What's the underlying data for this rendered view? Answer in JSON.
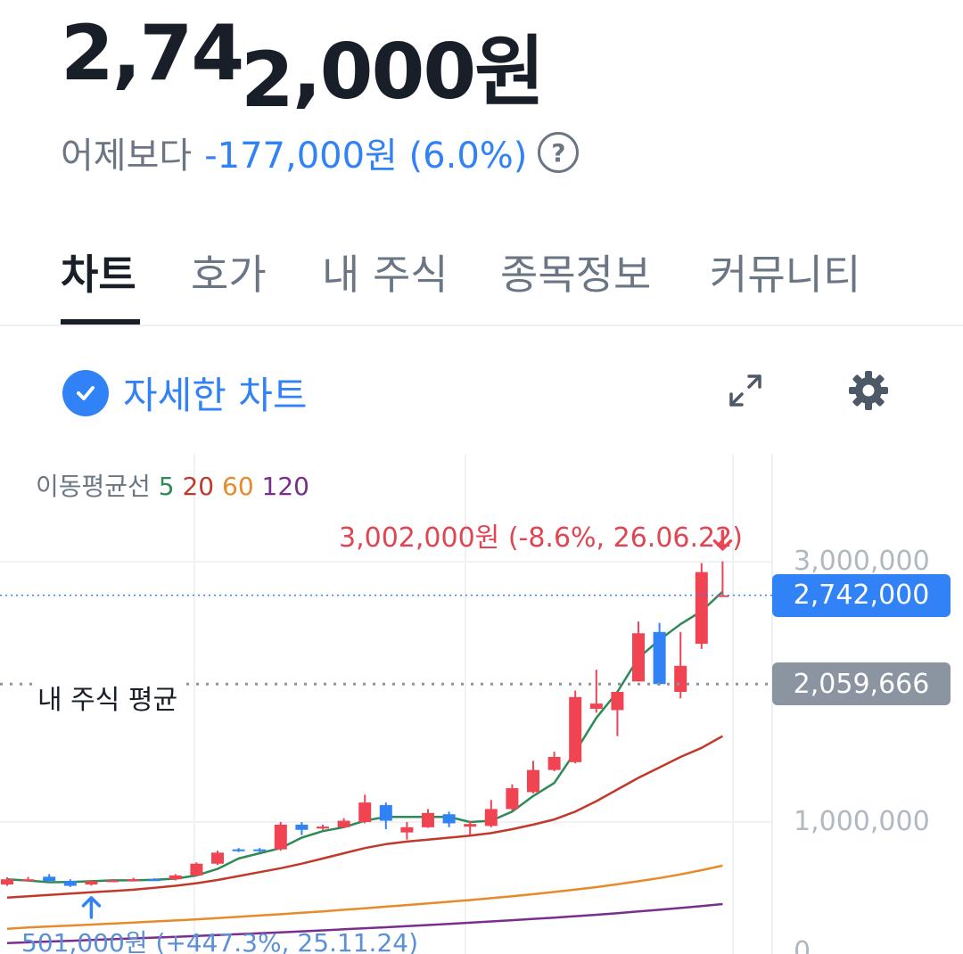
{
  "price": {
    "part_a": "2,74",
    "part_b": "2",
    "part_c": ",000원"
  },
  "change": {
    "label": "어제보다",
    "value": "-177,000원 (6.0%)",
    "help_icon": "question-circle-icon"
  },
  "tabs": [
    {
      "label": "차트",
      "active": true
    },
    {
      "label": "호가",
      "active": false
    },
    {
      "label": "내 주식",
      "active": false
    },
    {
      "label": "종목정보",
      "active": false
    },
    {
      "label": "커뮤니티",
      "active": false
    }
  ],
  "toolbar": {
    "detail_label": "자세한 차트",
    "detail_checked": true,
    "expand_icon": "expand-icon",
    "settings_icon": "gear-icon"
  },
  "colors": {
    "accent": "#3182f6",
    "up": "#f04452",
    "down": "#3182f6",
    "ma5": "#2e8b57",
    "ma20": "#c0392b",
    "ma60": "#e8892b",
    "ma120": "#7b2d8e",
    "avg_badge": "#8b95a1"
  },
  "chart": {
    "ma_title": "이동평균선",
    "ma_periods": [
      "5",
      "20",
      "60",
      "120"
    ],
    "y_labels": [
      "3,000,000",
      "1,000,000",
      "0"
    ],
    "current_price_badge": "2,742,000",
    "avg_badge": "2,059,666",
    "avg_label": "내 주식 평균",
    "high_label": "3,002,000원 (-8.6%, 26.06.22)",
    "low_label": "501,000원 (+447.3%, 25.11.24)"
  },
  "chart_data": {
    "type": "candlestick",
    "ylim": [
      0,
      3200000
    ],
    "gridlines": [
      1000000,
      3000000
    ],
    "candles": [
      {
        "o": 520000,
        "c": 560000,
        "h": 575000,
        "l": 510000
      },
      {
        "o": 555000,
        "c": 560000,
        "h": 578000,
        "l": 548000
      },
      {
        "o": 580000,
        "c": 548000,
        "h": 600000,
        "l": 540000
      },
      {
        "o": 548000,
        "c": 510000,
        "h": 560000,
        "l": 501000
      },
      {
        "o": 520000,
        "c": 545000,
        "h": 556000,
        "l": 512000
      },
      {
        "o": 545000,
        "c": 552000,
        "h": 562000,
        "l": 540000
      },
      {
        "o": 550000,
        "c": 560000,
        "h": 572000,
        "l": 544000
      },
      {
        "o": 560000,
        "c": 553000,
        "h": 568000,
        "l": 548000
      },
      {
        "o": 560000,
        "c": 590000,
        "h": 600000,
        "l": 552000
      },
      {
        "o": 590000,
        "c": 680000,
        "h": 690000,
        "l": 585000
      },
      {
        "o": 680000,
        "c": 765000,
        "h": 780000,
        "l": 670000
      },
      {
        "o": 790000,
        "c": 785000,
        "h": 800000,
        "l": 770000
      },
      {
        "o": 790000,
        "c": 785000,
        "h": 800000,
        "l": 770000
      },
      {
        "o": 790000,
        "c": 980000,
        "h": 1000000,
        "l": 780000
      },
      {
        "o": 980000,
        "c": 940000,
        "h": 1000000,
        "l": 900000
      },
      {
        "o": 950000,
        "c": 965000,
        "h": 980000,
        "l": 940000
      },
      {
        "o": 960000,
        "c": 1010000,
        "h": 1030000,
        "l": 955000
      },
      {
        "o": 1000000,
        "c": 1150000,
        "h": 1210000,
        "l": 990000
      },
      {
        "o": 1130000,
        "c": 1010000,
        "h": 1150000,
        "l": 945000
      },
      {
        "o": 920000,
        "c": 960000,
        "h": 1000000,
        "l": 865000
      },
      {
        "o": 960000,
        "c": 1070000,
        "h": 1100000,
        "l": 955000
      },
      {
        "o": 1060000,
        "c": 990000,
        "h": 1080000,
        "l": 960000
      },
      {
        "o": 965000,
        "c": 985000,
        "h": 1010000,
        "l": 900000
      },
      {
        "o": 970000,
        "c": 1100000,
        "h": 1170000,
        "l": 960000
      },
      {
        "o": 1100000,
        "c": 1260000,
        "h": 1290000,
        "l": 1090000
      },
      {
        "o": 1230000,
        "c": 1400000,
        "h": 1470000,
        "l": 1220000
      },
      {
        "o": 1400000,
        "c": 1500000,
        "h": 1540000,
        "l": 1390000
      },
      {
        "o": 1460000,
        "c": 1960000,
        "h": 2010000,
        "l": 1450000
      },
      {
        "o": 1870000,
        "c": 1910000,
        "h": 2170000,
        "l": 1840000
      },
      {
        "o": 1860000,
        "c": 2000000,
        "h": 2000000,
        "l": 1660000
      },
      {
        "o": 2080000,
        "c": 2450000,
        "h": 2540000,
        "l": 2080000
      },
      {
        "o": 2460000,
        "c": 2060000,
        "h": 2530000,
        "l": 2050000
      },
      {
        "o": 2000000,
        "c": 2200000,
        "h": 2460000,
        "l": 1950000
      },
      {
        "o": 2370000,
        "c": 2920000,
        "h": 2990000,
        "l": 2330000
      },
      {
        "o": 2742000,
        "c": 2742000,
        "h": 3002000,
        "l": 2742000
      }
    ],
    "ma5": [
      560000,
      551000,
      538000,
      540000,
      545000,
      552000,
      552000,
      556000,
      565000,
      590000,
      640000,
      720000,
      760000,
      800000,
      880000,
      930000,
      960000,
      1010000,
      1040000,
      1040000,
      1040000,
      1040000,
      1000000,
      1010000,
      1080000,
      1200000,
      1300000,
      1540000,
      1800000,
      2000000,
      2260000,
      2400000,
      2520000,
      2620000,
      2770000
    ],
    "ma20": [
      420000,
      430000,
      440000,
      450000,
      460000,
      470000,
      480000,
      495000,
      510000,
      530000,
      555000,
      585000,
      615000,
      645000,
      680000,
      720000,
      760000,
      800000,
      830000,
      850000,
      865000,
      880000,
      895000,
      915000,
      945000,
      980000,
      1020000,
      1080000,
      1160000,
      1250000,
      1340000,
      1420000,
      1500000,
      1570000,
      1660000
    ],
    "ma60": [
      180000,
      190000,
      198000,
      205000,
      212000,
      220000,
      228000,
      236000,
      244000,
      253000,
      262000,
      272000,
      282000,
      292000,
      303000,
      314000,
      326000,
      338000,
      350000,
      362000,
      375000,
      388000,
      401000,
      415000,
      430000,
      446000,
      463000,
      481000,
      500000,
      522000,
      545000,
      570000,
      598000,
      630000,
      665000
    ],
    "ma120": [
      70000,
      76000,
      82000,
      88000,
      94000,
      100000,
      106000,
      112000,
      118000,
      125000,
      132000,
      139000,
      146000,
      153000,
      160000,
      168000,
      176000,
      184000,
      192000,
      200000,
      209000,
      218000,
      227000,
      236000,
      246000,
      256000,
      266000,
      277000,
      288000,
      300000,
      313000,
      326000,
      340000,
      355000,
      370000
    ],
    "current": 2742000,
    "average": 2059666,
    "high": 3002000,
    "low": 501000
  }
}
